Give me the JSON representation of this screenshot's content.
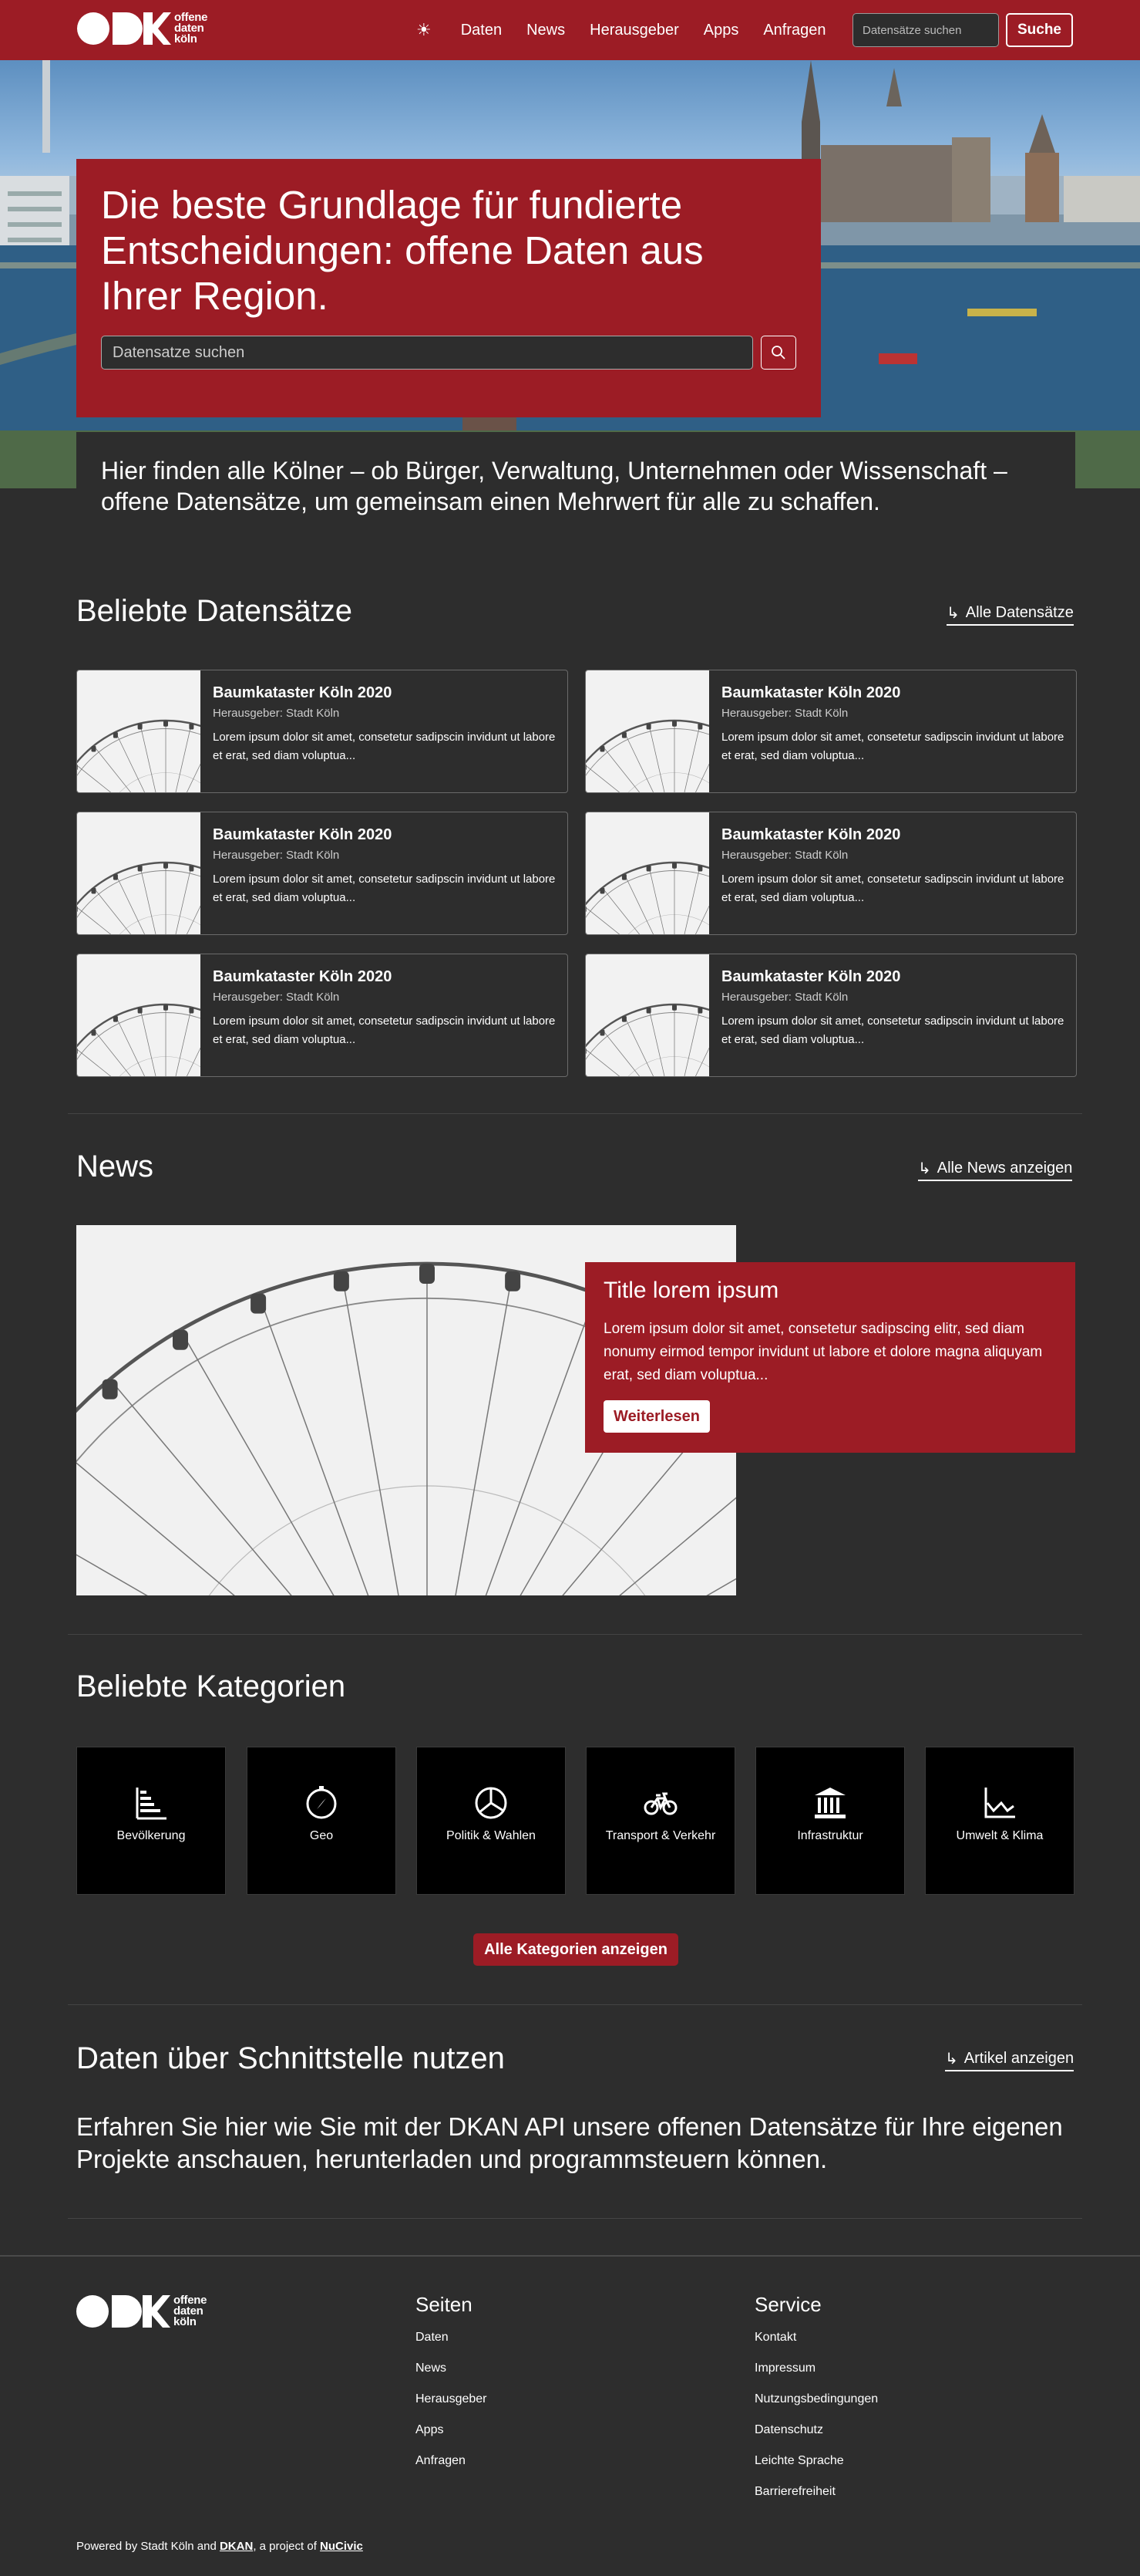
{
  "header": {
    "logo_text": [
      "offene",
      "daten",
      "köln"
    ],
    "theme_icon": "sun-icon",
    "nav": [
      "Daten",
      "News",
      "Herausgeber",
      "Apps",
      "Anfragen"
    ],
    "search_placeholder": "Datensätze suchen",
    "search_button": "Suche"
  },
  "hero": {
    "title": "Die beste Grundlage für fundierte Entscheidungen: offene Daten aus Ihrer Region.",
    "search_placeholder": "Datensatze suchen",
    "intro": "Hier finden alle Kölner – ob Bürger, Verwaltung, Unternehmen oder Wissenschaft – offene Datensätze, um gemeinsam einen Mehrwert für alle zu schaffen."
  },
  "datasets": {
    "title": "Beliebte Datensätze",
    "more": "Alle Datensätze",
    "items": [
      {
        "title": "Baumkataster Köln 2020",
        "publisher": "Herausgeber: Stadt Köln",
        "desc": "Lorem ipsum dolor sit amet, consetetur sadipscin invidunt ut labore et erat, sed diam voluptua..."
      },
      {
        "title": "Baumkataster Köln 2020",
        "publisher": "Herausgeber: Stadt Köln",
        "desc": "Lorem ipsum dolor sit amet, consetetur sadipscin invidunt ut labore et erat, sed diam voluptua..."
      },
      {
        "title": "Baumkataster Köln 2020",
        "publisher": "Herausgeber: Stadt Köln",
        "desc": "Lorem ipsum dolor sit amet, consetetur sadipscin invidunt ut labore et erat, sed diam voluptua..."
      },
      {
        "title": "Baumkataster Köln 2020",
        "publisher": "Herausgeber: Stadt Köln",
        "desc": "Lorem ipsum dolor sit amet, consetetur sadipscin invidunt ut labore et erat, sed diam voluptua..."
      },
      {
        "title": "Baumkataster Köln 2020",
        "publisher": "Herausgeber: Stadt Köln",
        "desc": "Lorem ipsum dolor sit amet, consetetur sadipscin invidunt ut labore et erat, sed diam voluptua..."
      },
      {
        "title": "Baumkataster Köln 2020",
        "publisher": "Herausgeber: Stadt Köln",
        "desc": "Lorem ipsum dolor sit amet, consetetur sadipscin invidunt ut labore et erat, sed diam voluptua..."
      }
    ]
  },
  "news": {
    "title": "News",
    "more": "Alle News anzeigen",
    "item_title": "Title lorem ipsum",
    "item_text": "Lorem ipsum dolor sit amet, consetetur sadipscing elitr, sed diam nonumy eirmod tempor invidunt ut labore et dolore magna aliquyam erat, sed diam voluptua...",
    "read_more": "Weiterlesen"
  },
  "categories": {
    "title": "Beliebte Kategorien",
    "items": [
      {
        "label": "Bevölkerung",
        "icon": "population-chart-icon"
      },
      {
        "label": "Geo",
        "icon": "compass-icon"
      },
      {
        "label": "Politik & Wahlen",
        "icon": "pie-chart-icon"
      },
      {
        "label": "Transport & Verkehr",
        "icon": "bicycle-icon"
      },
      {
        "label": "Infrastruktur",
        "icon": "building-icon"
      },
      {
        "label": "Umwelt & Klima",
        "icon": "line-chart-icon"
      }
    ],
    "button": "Alle Kategorien anzeigen"
  },
  "api": {
    "title": "Daten über Schnittstelle nutzen",
    "more": "Artikel anzeigen",
    "text": "Erfahren Sie hier wie Sie mit der DKAN API unsere offenen Datensätze für Ihre eigenen Projekte anschauen, herunterladen und programmsteuern können."
  },
  "footer": {
    "pages_title": "Seiten",
    "pages": [
      "Daten",
      "News",
      "Herausgeber",
      "Apps",
      "Anfragen"
    ],
    "service_title": "Service",
    "service": [
      "Kontakt",
      "Impressum",
      "Nutzungsbedingungen",
      "Datenschutz",
      "Leichte Sprache",
      "Barrierefreiheit"
    ],
    "powered_prefix": "Powered by Stadt Köln and",
    "powered_dkan": "DKAN",
    "powered_mid": ", a project of",
    "powered_nucivic": "NuCivic"
  },
  "colors": {
    "brand": "#9c1c25",
    "background": "#2d2d2d",
    "category_tile": "#000000"
  }
}
